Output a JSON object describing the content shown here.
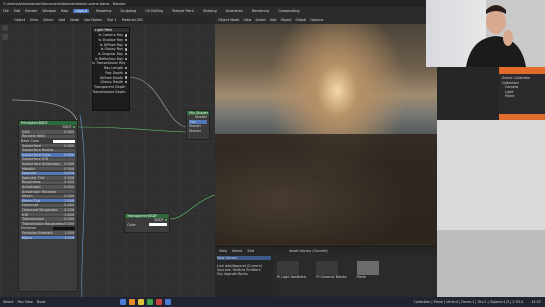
{
  "topbar": {
    "items": [
      "C:\\Users\\Administrator\\Documents\\blender\\beach-scene.blend - Blender"
    ]
  },
  "menubar": {
    "menus": [
      "File",
      "Edit",
      "Render",
      "Window",
      "Help"
    ],
    "tabs": [
      "Layout",
      "Modeling",
      "Sculpting",
      "UV Editing",
      "Texture Paint",
      "Shading",
      "Animation",
      "Rendering",
      "Compositing"
    ],
    "active_tab": "Layout"
  },
  "node_editor": {
    "header": [
      "Object",
      "View",
      "Select",
      "Add",
      "Node",
      "Use Nodes",
      "Slot 1",
      "Material.001"
    ],
    "light_path_node": {
      "title": "Light Path",
      "outputs": [
        "Is Camera Ray",
        "Is Shadow Ray",
        "Is Diffuse Ray",
        "Is Glossy Ray",
        "Is Singular Ray",
        "Is Reflection Ray",
        "Is Transmission Ray",
        "Ray Length",
        "Ray Depth",
        "Diffuse Depth",
        "Glossy Depth",
        "Transparent Depth",
        "Transmission Depth"
      ]
    },
    "bsdf_node": {
      "title": "Principled BSDF",
      "output": "BSDF",
      "rows": [
        "GGX",
        "Random Walk",
        "Base Color",
        "Subsurface",
        "Subsurface Radius",
        "Subsurface Color",
        "Subsurface IOR",
        "Subsurface Anisotropy",
        "Metallic",
        "Specular",
        "Specular Tint",
        "Roughness",
        "Anisotropic",
        "Anisotropic Rotation",
        "Sheen",
        "Sheen Tint",
        "Clearcoat",
        "Clearcoat Roughness",
        "IOR",
        "Transmission",
        "Transmission Roughness",
        "Emission",
        "Emission Strength",
        "Alpha"
      ],
      "values": [
        "0.000",
        "",
        "",
        "0.000",
        "",
        "0.500",
        "",
        "0.000",
        "0.500",
        "0.000",
        "0.500",
        "0.000",
        "0.000",
        "",
        "0.000",
        "1.000",
        "0.000",
        "0.030",
        "1.450",
        "0.000",
        "0.000",
        "",
        "1.000",
        "1.000"
      ]
    },
    "mix_node": {
      "title": "Mix Shader",
      "rows": [
        "Shader",
        "Fac",
        "Shader",
        "Shader"
      ]
    },
    "transparent_node": {
      "title": "Transparent BSDF",
      "output": "BSDF",
      "row": "Color"
    }
  },
  "viewport": {
    "header": [
      "Object Mode",
      "View",
      "Select",
      "Add",
      "Object",
      "Global",
      "Options"
    ]
  },
  "asset_browser": {
    "header": [
      "View",
      "Select",
      "Edit"
    ],
    "dropdown": "Asset Library (Current)",
    "side": [
      "Now Library",
      "Link Add/Append (Current)",
      "Sources: Particle Emitters",
      "Dry Asphalt Rocks"
    ],
    "items": [
      "Pl Light Aesthetic",
      "Pl Ceramic Blocks",
      "Plane"
    ]
  },
  "outliner": {
    "items": [
      "Scene Collection",
      "Collection",
      "Camera",
      "Light",
      "Plane"
    ]
  },
  "statusbar": {
    "left": [
      "Select",
      "Pan View",
      "Node"
    ],
    "right": "Collection | Plane | Verts:4 | Faces:1 | Tris:2 | Objects:1/3 | 2.93.0",
    "time": "14:22"
  }
}
